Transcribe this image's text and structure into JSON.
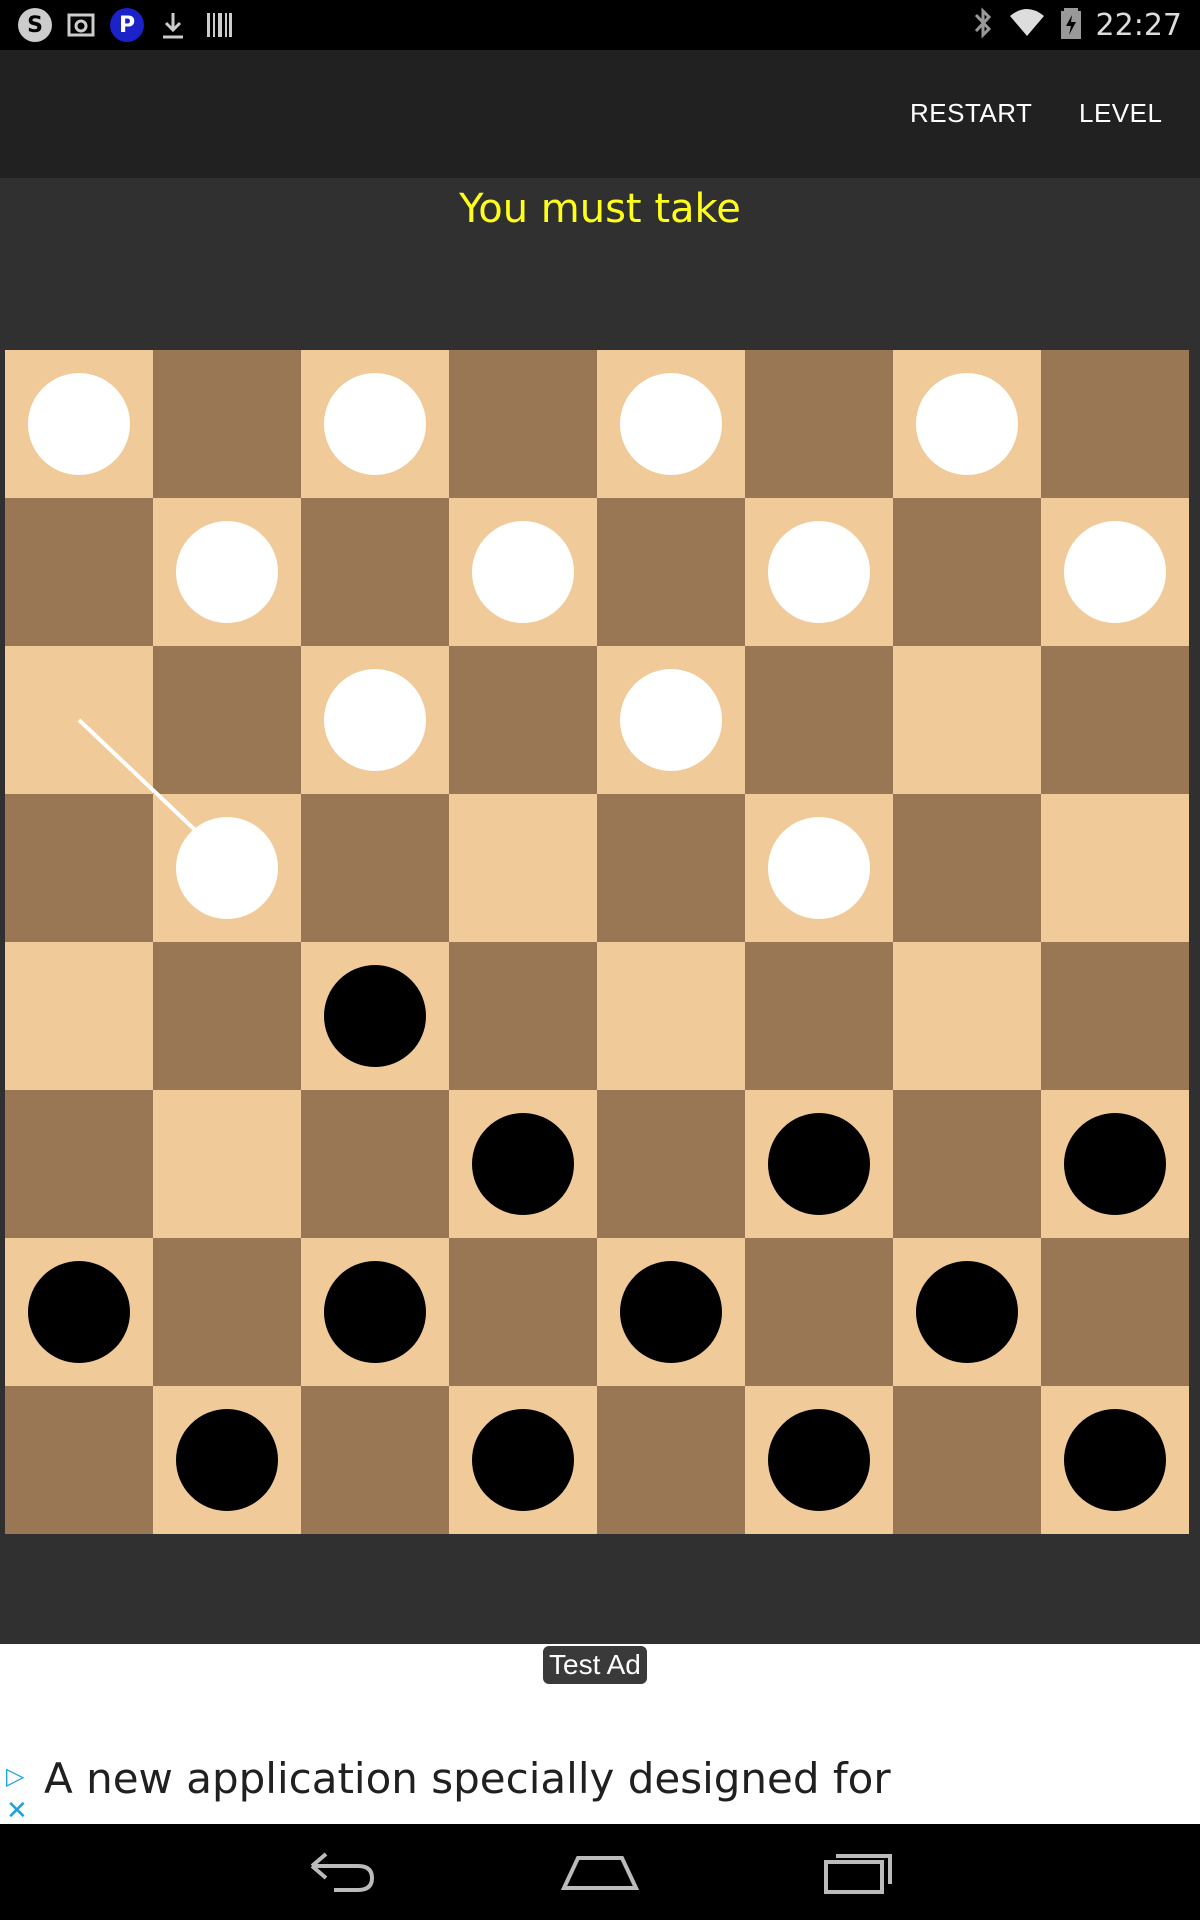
{
  "status_bar": {
    "left_icons": [
      "skype-icon",
      "gallery-icon",
      "p-badge-icon",
      "download-icon",
      "barcode-icon"
    ],
    "p_badge_text": "P",
    "skype_text": "S",
    "time": "22:27"
  },
  "toolbar": {
    "restart_label": "RESTART",
    "level_label": "LEVEL"
  },
  "game": {
    "message": "You must take",
    "colors": {
      "light": "#f0ca98",
      "dark": "#997754",
      "white_piece": "#ffffff",
      "black_piece": "#000000",
      "message": "#ffff1a"
    },
    "board_rows": [
      "W.W.W.W.",
      ".W.W.W.W",
      "..W.W...",
      ".W...W..",
      "..B.....",
      "...B.B.B",
      "B.B.B.B.",
      ".B.B.B.B"
    ],
    "move_hint": {
      "from": [
        2,
        0
      ],
      "to": [
        3,
        1
      ]
    }
  },
  "ad": {
    "badge": "Test Ad",
    "text": "A new application specially designed for"
  },
  "nav": {
    "icons": [
      "back-icon",
      "home-icon",
      "recents-icon"
    ]
  }
}
